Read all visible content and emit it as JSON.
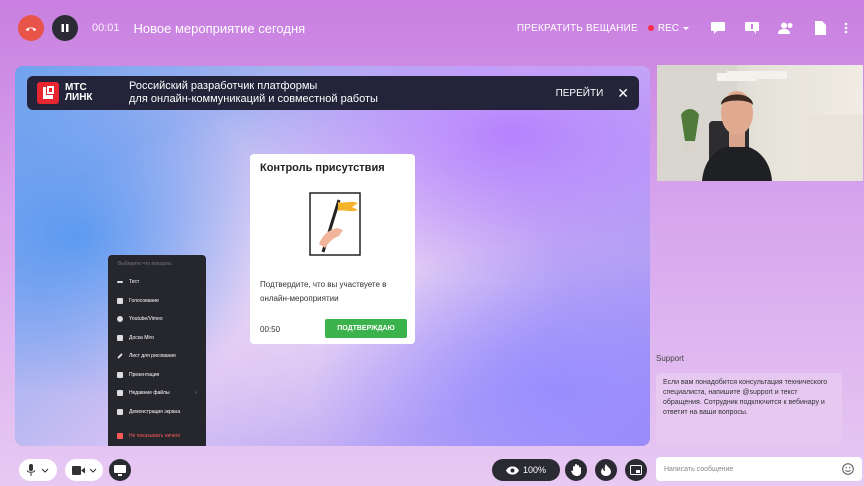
{
  "header": {
    "timer": "00:01",
    "title": "Новое мероприятие сегодня",
    "stop_broadcast": "ПРЕКРАТИТЬ ВЕЩАНИЕ",
    "rec": "REC"
  },
  "banner": {
    "logo_line1": "МТС",
    "logo_line2": "ЛИНК",
    "text_line1": "Российский разработчик платформы",
    "text_line2": "для онлайн-коммуникаций и совместной работы",
    "go": "ПЕРЕЙТИ",
    "close": "✕"
  },
  "presence": {
    "title": "Контроль присутствия",
    "text": "Подтвердите, что вы участвуете в онлайн-мероприятии",
    "timer": "00:50",
    "confirm": "ПОДТВЕРЖДАЮ"
  },
  "menu": {
    "header": "Выберите что показать",
    "items": [
      {
        "label": "Тест",
        "icon": "list-icon"
      },
      {
        "label": "Голосование",
        "icon": "poll-icon"
      },
      {
        "label": "Youtube/Vimeo",
        "icon": "video-icon"
      },
      {
        "label": "Доска Miro",
        "icon": "board-icon"
      },
      {
        "label": "Лист для рисования",
        "icon": "pencil-icon"
      },
      {
        "label": "Презентация",
        "icon": "presentation-icon"
      },
      {
        "label": "Недавние файлы",
        "icon": "files-icon"
      },
      {
        "label": "Демонстрация экрана",
        "icon": "screen-icon"
      }
    ],
    "stop": "Не показывать ничего"
  },
  "bottom": {
    "zoom": "100%"
  },
  "chat": {
    "support_label": "Support",
    "support_message": "Если вам понадобится консультация технического специалиста, напишите @support и текст обращения. Сотрудник подключится к вебинару и ответит на ваши вопросы.",
    "input_placeholder": "Написать сообщение"
  },
  "colors": {
    "hangup": "#e8544a",
    "banner_bg": "#23243a",
    "logo_red": "#e7262f",
    "confirm_green": "#3bb24b",
    "menu_bg": "#26262d",
    "rec_dot": "#ff2d4a"
  }
}
